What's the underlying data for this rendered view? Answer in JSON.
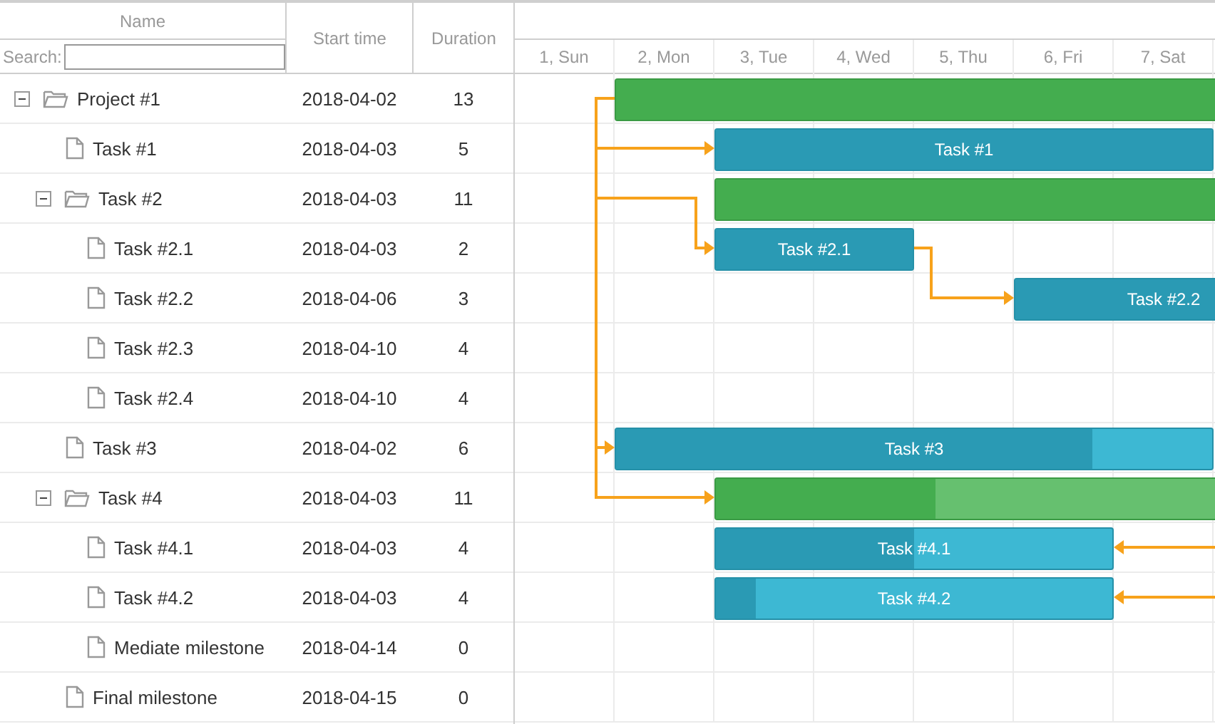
{
  "columns": {
    "name": "Name",
    "start": "Start time",
    "duration": "Duration"
  },
  "search": {
    "label": "Search:"
  },
  "days": [
    "1, Sun",
    "2, Mon",
    "3, Tue",
    "4, Wed",
    "5, Thu",
    "6, Fri",
    "7, Sat"
  ],
  "tasks": [
    {
      "name": "Project #1",
      "start": "2018-04-02",
      "duration": "13",
      "kind": "project",
      "expanded": true,
      "bar": {
        "level": 0.5
      },
      "children": [
        {
          "name": "Task #1",
          "start": "2018-04-03",
          "duration": "5",
          "kind": "task",
          "bar": {
            "level": 1,
            "label": "Task #1"
          }
        },
        {
          "name": "Task #2",
          "start": "2018-04-03",
          "duration": "11",
          "kind": "project",
          "expanded": true,
          "bar": {
            "level": 0.5
          },
          "children": [
            {
              "name": "Task #2.1",
              "start": "2018-04-03",
              "duration": "2",
              "kind": "task",
              "bar": {
                "level": 1,
                "label": "Task #2.1"
              }
            },
            {
              "name": "Task #2.2",
              "start": "2018-04-06",
              "duration": "3",
              "kind": "task",
              "bar": {
                "level": 0.7,
                "label": "Task #2.2"
              }
            },
            {
              "name": "Task #2.3",
              "start": "2018-04-10",
              "duration": "4",
              "kind": "task"
            },
            {
              "name": "Task #2.4",
              "start": "2018-04-10",
              "duration": "4",
              "kind": "task"
            }
          ]
        },
        {
          "name": "Task #3",
          "start": "2018-04-02",
          "duration": "6",
          "kind": "task",
          "bar": {
            "level": 0.8,
            "label": "Task #3"
          }
        },
        {
          "name": "Task #4",
          "start": "2018-04-03",
          "duration": "11",
          "kind": "project",
          "expanded": true,
          "bar": {
            "level": 0.2
          },
          "children": [
            {
              "name": "Task #4.1",
              "start": "2018-04-03",
              "duration": "4",
              "kind": "task",
              "bar": {
                "level": 0.5,
                "label": "Task #4.1"
              }
            },
            {
              "name": "Task #4.2",
              "start": "2018-04-03",
              "duration": "4",
              "kind": "task",
              "bar": {
                "level": 0.1,
                "label": "Task #4.2"
              }
            },
            {
              "name": "Mediate milestone",
              "start": "2018-04-14",
              "duration": "0",
              "kind": "task"
            }
          ]
        },
        {
          "name": "Final milestone",
          "start": "2018-04-15",
          "duration": "0",
          "kind": "task"
        }
      ]
    }
  ]
}
